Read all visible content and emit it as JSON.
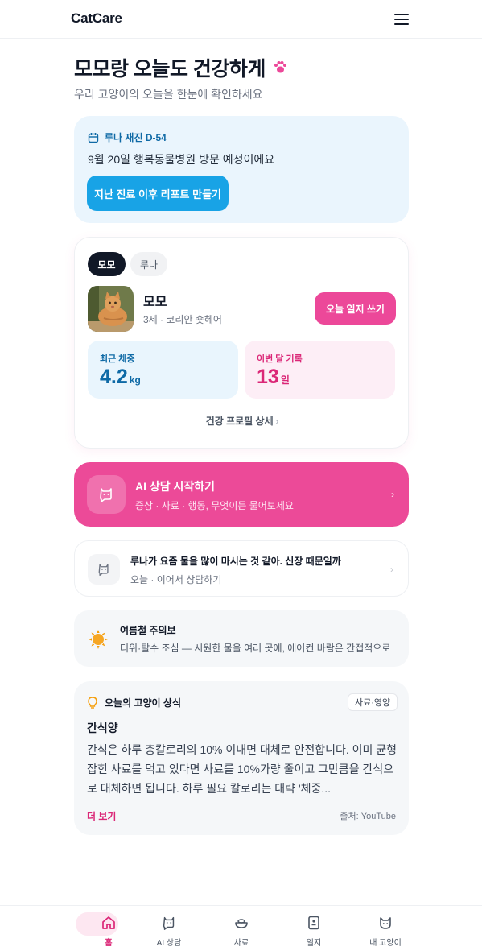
{
  "app": {
    "title": "CatCare"
  },
  "hero": {
    "title": "모모랑 오늘도 건강하게",
    "subtitle": "우리 고양이의 오늘을 한눈에 확인하세요"
  },
  "recheck": {
    "title": "루나 재진 D-54",
    "text": "9월 20일 행복동물병원 방문 예정이에요",
    "button": "지난 진료 이후 리포트 만들기"
  },
  "pet_card": {
    "tabs": [
      {
        "label": "모모",
        "active": true
      },
      {
        "label": "루나",
        "active": false
      }
    ],
    "name": "모모",
    "info": "3세 · 코리안 숏헤어",
    "diary_button": "오늘 일지 쓰기",
    "weight": {
      "label": "최근 체중",
      "value": "4.2",
      "unit": "kg"
    },
    "records": {
      "label": "이번 달 기록",
      "value": "13",
      "unit": "일"
    },
    "profile_link": "건강 프로필 상세",
    "profile_chevron": "›"
  },
  "ai_start": {
    "title": "AI 상담 시작하기",
    "subtitle": "증상 · 사료 · 행동, 무엇이든 물어보세요",
    "chevron": "›"
  },
  "recent_chat": {
    "title": "루나가 요즘 물을 많이 마시는 것 같아. 신장 때문일까",
    "subtitle": "오늘 · 이어서 상담하기",
    "chevron": "›"
  },
  "summer_alert": {
    "title": "여름철 주의보",
    "text": "더위·탈수 조심 — 시원한 물을 여러 곳에, 에어컨 바람은 간접적으로"
  },
  "tip": {
    "label": "오늘의 고양이 상식",
    "tag": "사료·영양",
    "title": "간식양",
    "body": "간식은 하루 총칼로리의 10% 이내면 대체로 안전합니다. 이미 균형 잡힌 사료를 먹고 있다면 사료를 10%가량 줄이고 그만큼을 간식으로 대체하면 됩니다. 하루 필요 칼로리는 대략 '체중...",
    "more": "더 보기",
    "source": "출처: YouTube"
  },
  "nav": [
    {
      "label": "홈",
      "icon": "home-icon",
      "active": true
    },
    {
      "label": "AI 상담",
      "icon": "chat-bot-icon",
      "active": false
    },
    {
      "label": "사료",
      "icon": "food-bowl-icon",
      "active": false
    },
    {
      "label": "일지",
      "icon": "diary-icon",
      "active": false
    },
    {
      "label": "내 고양이",
      "icon": "cat-icon",
      "active": false
    }
  ],
  "colors": {
    "accent_pink": "#ec4899",
    "accent_blue": "#18a3e6",
    "dark": "#111827"
  }
}
